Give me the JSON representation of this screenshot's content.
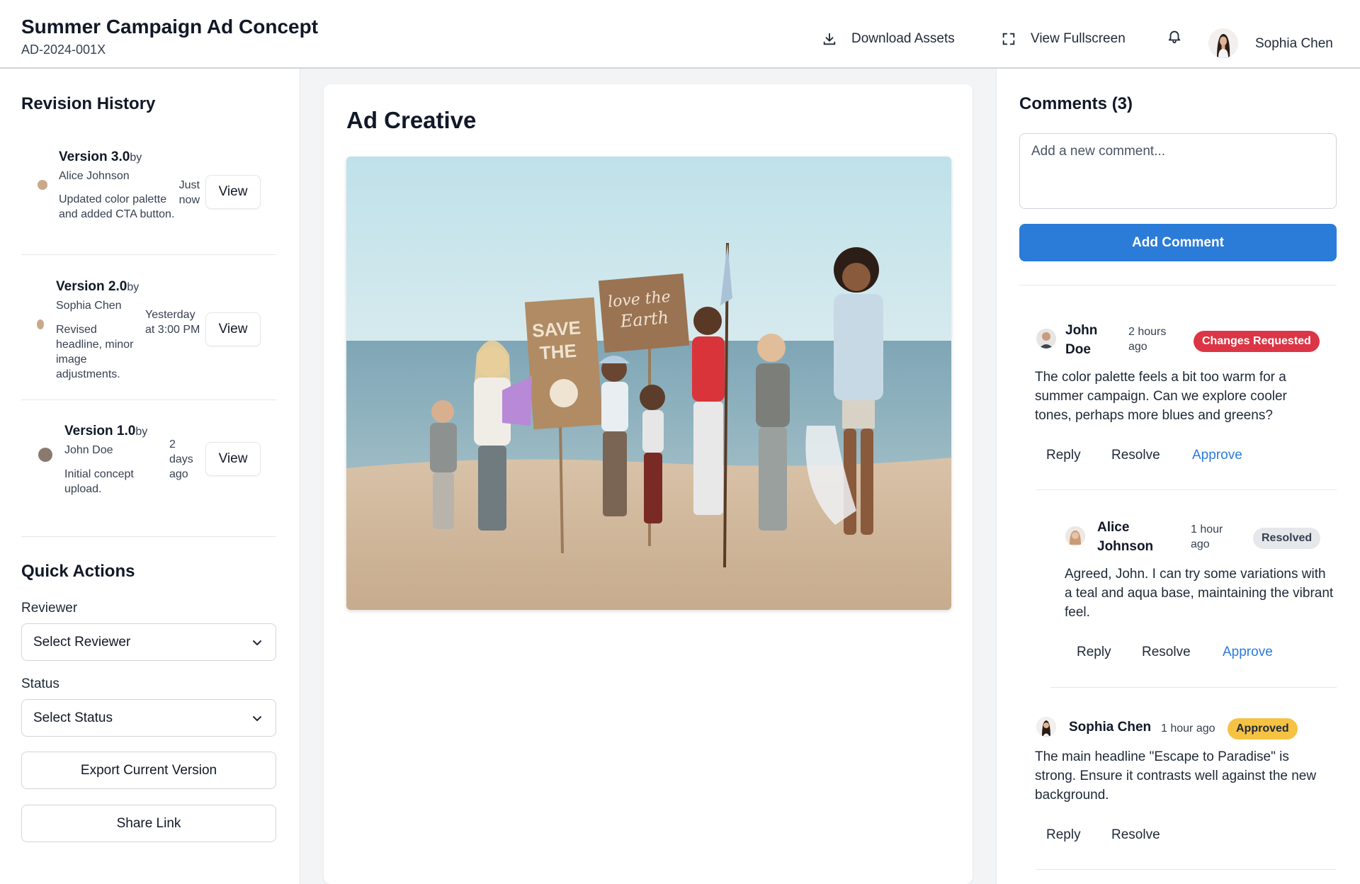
{
  "header": {
    "title": "Summer Campaign Ad Concept",
    "ad_id": "AD-2024-001X",
    "download_label": "Download Assets",
    "fullscreen_label": "View Fullscreen",
    "user_name": "Sophia Chen"
  },
  "revisions": {
    "title": "Revision History",
    "items": [
      {
        "version": "Version 3.0",
        "by": "by",
        "author": "Alice Johnson",
        "desc": "Updated color palette and added CTA button.",
        "time": "Just now",
        "button": "View"
      },
      {
        "version": "Version 2.0",
        "by": "by",
        "author": "Sophia Chen",
        "desc": "Revised headline, minor image adjustments.",
        "time": "Yesterday at 3:00 PM",
        "button": "View"
      },
      {
        "version": "Version 1.0",
        "by": "by",
        "author": "John Doe",
        "desc": "Initial concept upload.",
        "time": "2 days ago",
        "button": "View"
      }
    ]
  },
  "quick_actions": {
    "title": "Quick Actions",
    "reviewer_label": "Reviewer",
    "reviewer_value": "Select Reviewer",
    "status_label": "Status",
    "status_value": "Select Status",
    "export_label": "Export Current Version",
    "share_label": "Share Link"
  },
  "creative": {
    "title": "Ad Creative",
    "sign_left": "SAVE THE",
    "sign_right": "love the Earth"
  },
  "comments": {
    "title": "Comments (3)",
    "placeholder": "Add a new comment...",
    "add_label": "Add Comment",
    "items": [
      {
        "name": "John Doe",
        "time": "2 hours ago",
        "badge": "Changes Requested",
        "text": "The color palette feels a bit too warm for a summer campaign. Can we explore cooler tones, perhaps more blues and greens?",
        "actions": [
          "Reply",
          "Resolve",
          "Approve"
        ]
      },
      {
        "name": "Alice Johnson",
        "time": "1 hour ago",
        "badge": "Resolved",
        "text": "Agreed, John. I can try some variations with a teal and aqua base, maintaining the vibrant feel.",
        "actions": [
          "Reply",
          "Resolve",
          "Approve"
        ]
      },
      {
        "name": "Sophia Chen",
        "time": "1 hour ago",
        "badge": "Approved",
        "text": "The main headline \"Escape to Paradise\" is strong. Ensure it contrasts well against the new background.",
        "actions": [
          "Reply",
          "Resolve"
        ]
      }
    ]
  },
  "colors": {
    "primary": "#2b7bd9",
    "changes_requested": "#dc3545",
    "resolved": "#e5e7eb",
    "approved": "#f6c244"
  }
}
